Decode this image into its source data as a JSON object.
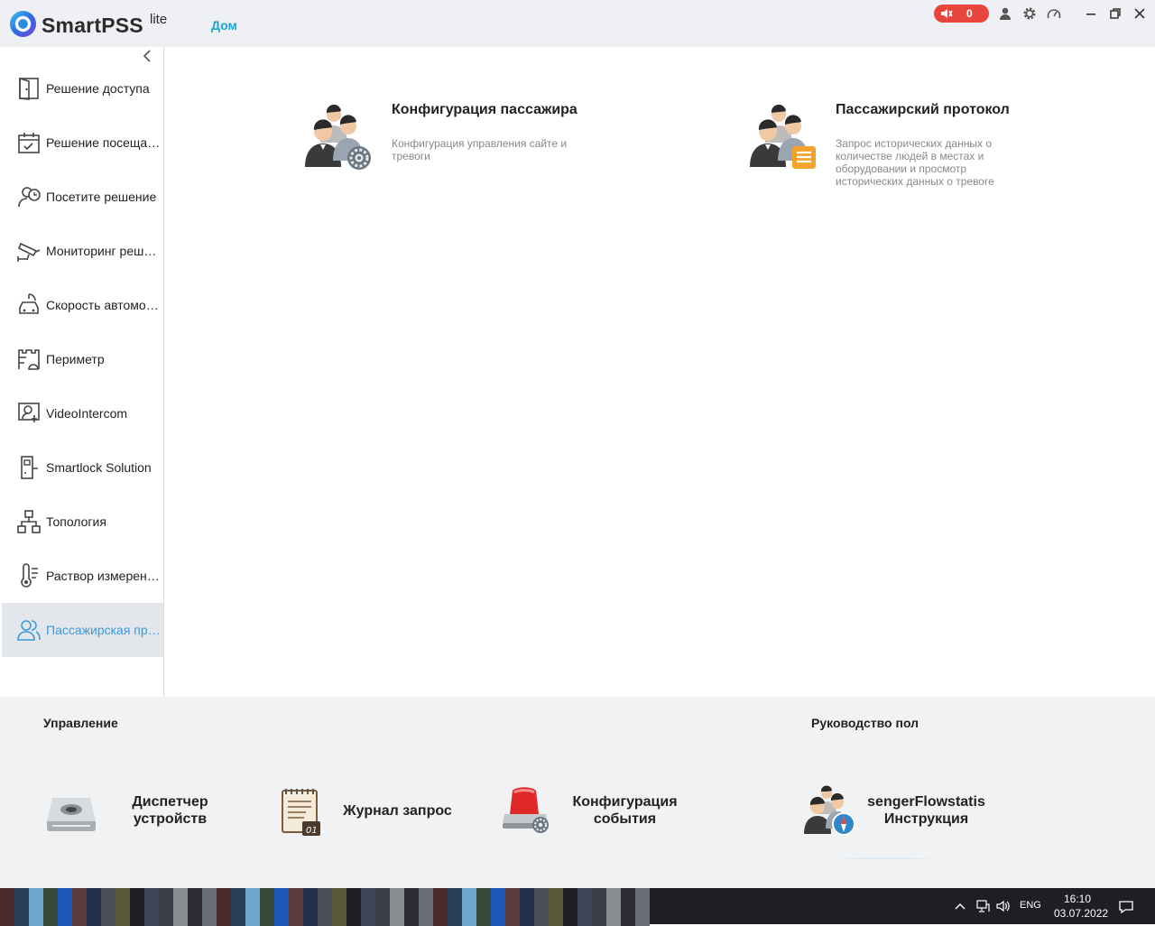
{
  "app": {
    "brand": "SmartPSS",
    "brand_sup": "lite",
    "home_tab": "Дом",
    "alarm_count": "0"
  },
  "sidebar": {
    "items": [
      {
        "label": "Решение доступа",
        "icon": "door-icon"
      },
      {
        "label": "Решение посещаемости",
        "icon": "calendar-check-icon"
      },
      {
        "label": "Посетите решение",
        "icon": "visitor-clock-icon"
      },
      {
        "label": "Мониторинг решений",
        "icon": "camera-icon"
      },
      {
        "label": "Скорость автомобиля",
        "icon": "car-speed-icon"
      },
      {
        "label": "Периметр",
        "icon": "perimeter-icon"
      },
      {
        "label": "VideoIntercom",
        "icon": "intercom-icon"
      },
      {
        "label": "Smartlock Solution",
        "icon": "smartlock-icon"
      },
      {
        "label": "Топология",
        "icon": "topology-icon"
      },
      {
        "label": "Раствор измерения температуры",
        "icon": "thermometer-icon"
      },
      {
        "label": "Пассажирская програма",
        "icon": "people-icon"
      }
    ],
    "active_index": 10
  },
  "cards": [
    {
      "title": "Конфигурация пассажира",
      "desc": [
        "Конфигурация управления сайте и",
        "тревоги"
      ]
    },
    {
      "title": "Пассажирский протокол",
      "desc": [
        "Запрос исторических данных о",
        "количестве людей в местах и",
        "оборудовании и просмотр",
        "исторических данных о тревоге"
      ]
    }
  ],
  "bottom": {
    "manage_title": "Управление",
    "guide_title": "Руководство пол",
    "tools": [
      {
        "label": [
          "Диспетчер",
          "устройств"
        ]
      },
      {
        "label": [
          "Журнал запрос"
        ]
      },
      {
        "label": [
          "Конфигурация",
          "события"
        ]
      }
    ],
    "guide": {
      "label": [
        "sengerFlowstatis",
        "Инструкция"
      ]
    }
  },
  "taskbar": {
    "lang": "ENG",
    "time": "16:10",
    "date": "03.07.2022"
  },
  "colors": {
    "accent": "#1ea5dc",
    "alarm": "#e8453c",
    "active_item": "#3d9ad9"
  }
}
